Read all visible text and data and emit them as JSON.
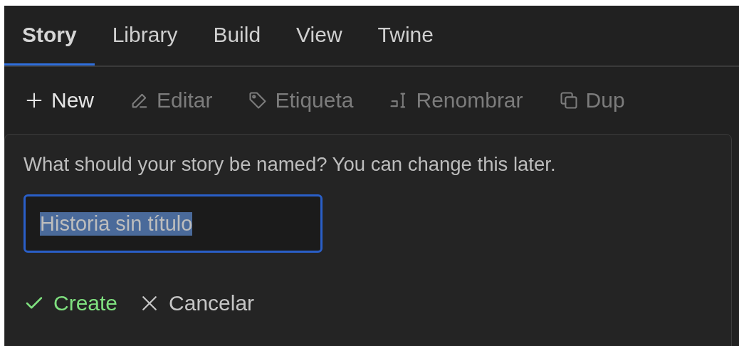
{
  "tabs": [
    {
      "label": "Story",
      "selected": true
    },
    {
      "label": "Library",
      "selected": false
    },
    {
      "label": "Build",
      "selected": false
    },
    {
      "label": "View",
      "selected": false
    },
    {
      "label": "Twine",
      "selected": false
    }
  ],
  "toolbar": [
    {
      "kind": "new",
      "label": "New",
      "disabled": false
    },
    {
      "kind": "edit",
      "label": "Editar",
      "disabled": true
    },
    {
      "kind": "tag",
      "label": "Etiqueta",
      "disabled": true
    },
    {
      "kind": "rename",
      "label": "Renombrar",
      "disabled": true
    },
    {
      "kind": "duplicate",
      "label": "Dup",
      "disabled": true
    }
  ],
  "dialog": {
    "prompt": "What should your story be named? You can change this later.",
    "name_field": {
      "value": "Historia sin título",
      "text_selected": true
    },
    "buttons": [
      {
        "kind": "confirm",
        "label": "Create"
      },
      {
        "kind": "cancel",
        "label": "Cancelar"
      }
    ]
  }
}
